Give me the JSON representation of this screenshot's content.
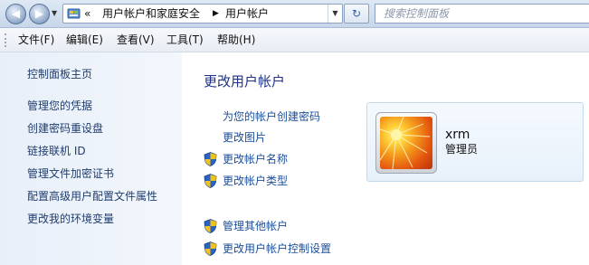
{
  "address_bar": {
    "breadcrumb": [
      "用户帐户和家庭安全",
      "用户帐户"
    ],
    "overflow_marker": "«",
    "search_placeholder": "搜索控制面板"
  },
  "menu": {
    "items": [
      "文件(F)",
      "编辑(E)",
      "查看(V)",
      "工具(T)",
      "帮助(H)"
    ]
  },
  "sidebar": {
    "home": "控制面板主页",
    "items": [
      "管理您的凭据",
      "创建密码重设盘",
      "链接联机 ID",
      "管理文件加密证书",
      "配置高级用户配置文件属性",
      "更改我的环境变量"
    ]
  },
  "main": {
    "title": "更改用户帐户",
    "links": [
      {
        "label": "为您的帐户创建密码",
        "shield": false
      },
      {
        "label": "更改图片",
        "shield": false
      },
      {
        "label": "更改帐户名称",
        "shield": true
      },
      {
        "label": "更改帐户类型",
        "shield": true
      }
    ],
    "other_links": [
      {
        "label": "管理其他帐户",
        "shield": true
      },
      {
        "label": "更改用户帐户控制设置",
        "shield": true
      }
    ]
  },
  "user": {
    "name": "xrm",
    "role": "管理员"
  },
  "icons": {
    "back": "back-arrow-icon",
    "forward": "forward-arrow-icon",
    "refresh": "refresh-icon",
    "search": "search-icon",
    "help": "help-icon",
    "uac": "uac-shield-icon"
  }
}
